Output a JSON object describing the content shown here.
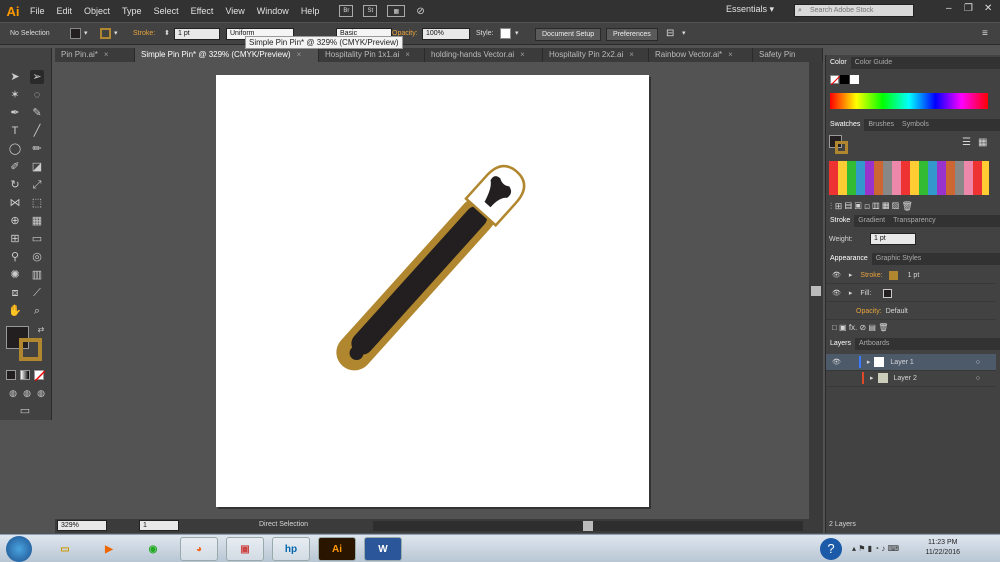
{
  "app": {
    "logo": "Ai"
  },
  "menu": [
    "File",
    "Edit",
    "Object",
    "Type",
    "Select",
    "Effect",
    "View",
    "Window",
    "Help"
  ],
  "menu_icons": {
    "bridge": "Br",
    "stock": "St"
  },
  "workspace": "Essentials",
  "search": {
    "placeholder": "Search Adobe Stock"
  },
  "control": {
    "selection": "No Selection",
    "stroke_label": "Stroke:",
    "stroke_weight": "1 pt",
    "brush": "Uniform",
    "style_label": "Basic",
    "opacity_label": "Opacity:",
    "opacity": "100%",
    "style_word": "Style:",
    "doc_setup": "Document Setup",
    "preferences": "Preferences"
  },
  "tooltip": "Simple Pin Pin* @ 329% (CMYK/Preview)",
  "tabs": [
    {
      "label": "Pin Pin.ai*"
    },
    {
      "label": "Simple Pin Pin* @ 329% (CMYK/Preview)"
    },
    {
      "label": "Hospitality Pin 1x1.ai"
    },
    {
      "label": "holding-hands Vector.ai"
    },
    {
      "label": "Hospitality Pin 2x2.ai"
    },
    {
      "label": "Rainbow Vector.ai*"
    },
    {
      "label": "Safety Pin"
    }
  ],
  "status": {
    "zoom": "329%",
    "page": "1",
    "tool": "Direct Selection"
  },
  "panels": {
    "color_tabs": [
      "Color",
      "Color Guide"
    ],
    "swatch_tabs": [
      "Swatches",
      "Brushes",
      "Symbols"
    ],
    "stroke_tabs": [
      "Stroke",
      "Gradient",
      "Transparency"
    ],
    "weight_label": "Weight:",
    "weight": "1 pt",
    "appearance_tabs": [
      "Appearance",
      "Graphic Styles"
    ],
    "appearance_rows": [
      {
        "label": "Stroke:",
        "value": "1 pt"
      },
      {
        "label": "Fill:",
        "value": ""
      },
      {
        "label": "Opacity:",
        "value": "Default"
      }
    ],
    "layers_tabs": [
      "Layers",
      "Artboards"
    ],
    "layers": [
      {
        "name": "Layer 1"
      },
      {
        "name": "Layer 2"
      }
    ],
    "layers_count": "2 Layers"
  },
  "colors": {
    "pin_gold": "#b0862e",
    "pin_dark": "#231f20"
  },
  "clock": {
    "time": "11:23 PM",
    "date": "11/22/2016"
  }
}
